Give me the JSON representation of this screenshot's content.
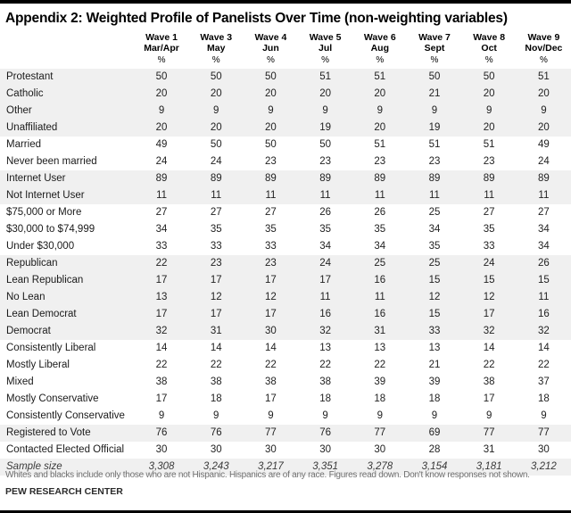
{
  "title": "Appendix 2: Weighted Profile of Panelists Over Time (non-weighting variables)",
  "row_label_header": "",
  "columns": [
    {
      "wave": "Wave 1",
      "period": "Mar/Apr",
      "unit": "%"
    },
    {
      "wave": "Wave 3",
      "period": "May",
      "unit": "%"
    },
    {
      "wave": "Wave 4",
      "period": "Jun",
      "unit": "%"
    },
    {
      "wave": "Wave 5",
      "period": "Jul",
      "unit": "%"
    },
    {
      "wave": "Wave 6",
      "period": "Aug",
      "unit": "%"
    },
    {
      "wave": "Wave 7",
      "period": "Sept",
      "unit": "%"
    },
    {
      "wave": "Wave 8",
      "period": "Oct",
      "unit": "%"
    },
    {
      "wave": "Wave 9",
      "period": "Nov/Dec",
      "unit": "%"
    }
  ],
  "rows": [
    {
      "label": "Protestant",
      "band": "shaded",
      "values": [
        "50",
        "50",
        "50",
        "51",
        "51",
        "50",
        "50",
        "51"
      ]
    },
    {
      "label": "Catholic",
      "band": "shaded",
      "values": [
        "20",
        "20",
        "20",
        "20",
        "20",
        "21",
        "20",
        "20"
      ]
    },
    {
      "label": "Other",
      "band": "shaded",
      "values": [
        "9",
        "9",
        "9",
        "9",
        "9",
        "9",
        "9",
        "9"
      ]
    },
    {
      "label": "Unaffiliated",
      "band": "shaded",
      "values": [
        "20",
        "20",
        "20",
        "19",
        "20",
        "19",
        "20",
        "20"
      ]
    },
    {
      "label": "Married",
      "band": "plain",
      "values": [
        "49",
        "50",
        "50",
        "50",
        "51",
        "51",
        "51",
        "49"
      ]
    },
    {
      "label": "Never been married",
      "band": "plain",
      "values": [
        "24",
        "24",
        "23",
        "23",
        "23",
        "23",
        "23",
        "24"
      ]
    },
    {
      "label": "Internet User",
      "band": "shaded",
      "values": [
        "89",
        "89",
        "89",
        "89",
        "89",
        "89",
        "89",
        "89"
      ]
    },
    {
      "label": "Not Internet User",
      "band": "shaded",
      "values": [
        "11",
        "11",
        "11",
        "11",
        "11",
        "11",
        "11",
        "11"
      ]
    },
    {
      "label": "$75,000 or More",
      "band": "plain",
      "values": [
        "27",
        "27",
        "27",
        "26",
        "26",
        "25",
        "27",
        "27"
      ]
    },
    {
      "label": "$30,000 to $74,999",
      "band": "plain",
      "values": [
        "34",
        "35",
        "35",
        "35",
        "35",
        "34",
        "35",
        "34"
      ]
    },
    {
      "label": "Under $30,000",
      "band": "plain",
      "values": [
        "33",
        "33",
        "33",
        "34",
        "34",
        "35",
        "33",
        "34"
      ]
    },
    {
      "label": "Republican",
      "band": "shaded",
      "values": [
        "22",
        "23",
        "23",
        "24",
        "25",
        "25",
        "24",
        "26"
      ]
    },
    {
      "label": "Lean Republican",
      "band": "shaded",
      "values": [
        "17",
        "17",
        "17",
        "17",
        "16",
        "15",
        "15",
        "15"
      ]
    },
    {
      "label": "No Lean",
      "band": "shaded",
      "values": [
        "13",
        "12",
        "12",
        "11",
        "11",
        "12",
        "12",
        "11"
      ]
    },
    {
      "label": "Lean Democrat",
      "band": "shaded",
      "values": [
        "17",
        "17",
        "17",
        "16",
        "16",
        "15",
        "17",
        "16"
      ]
    },
    {
      "label": "Democrat",
      "band": "shaded",
      "values": [
        "32",
        "31",
        "30",
        "32",
        "31",
        "33",
        "32",
        "32"
      ]
    },
    {
      "label": "Consistently Liberal",
      "band": "plain",
      "values": [
        "14",
        "14",
        "14",
        "13",
        "13",
        "13",
        "14",
        "14"
      ]
    },
    {
      "label": "Mostly Liberal",
      "band": "plain",
      "values": [
        "22",
        "22",
        "22",
        "22",
        "22",
        "21",
        "22",
        "22"
      ]
    },
    {
      "label": "Mixed",
      "band": "plain",
      "values": [
        "38",
        "38",
        "38",
        "38",
        "39",
        "39",
        "38",
        "37"
      ]
    },
    {
      "label": "Mostly Conservative",
      "band": "plain",
      "values": [
        "17",
        "18",
        "17",
        "18",
        "18",
        "18",
        "17",
        "18"
      ]
    },
    {
      "label": "Consistently Conservative",
      "band": "plain",
      "values": [
        "9",
        "9",
        "9",
        "9",
        "9",
        "9",
        "9",
        "9"
      ]
    },
    {
      "label": "Registered to Vote",
      "band": "shaded",
      "values": [
        "76",
        "76",
        "77",
        "76",
        "77",
        "69",
        "77",
        "77"
      ]
    },
    {
      "label": "Contacted Elected Official",
      "band": "plain",
      "values": [
        "30",
        "30",
        "30",
        "30",
        "30",
        "28",
        "31",
        "30"
      ]
    },
    {
      "label": "Sample size",
      "band": "samplesize",
      "values": [
        "3,308",
        "3,243",
        "3,217",
        "3,351",
        "3,278",
        "3,154",
        "3,181",
        "3,212"
      ]
    }
  ],
  "note": "Whites and blacks include only those who are not Hispanic. Hispanics are of any race. Figures read down. Don't know responses not shown.",
  "source": "PEW RESEARCH CENTER"
}
